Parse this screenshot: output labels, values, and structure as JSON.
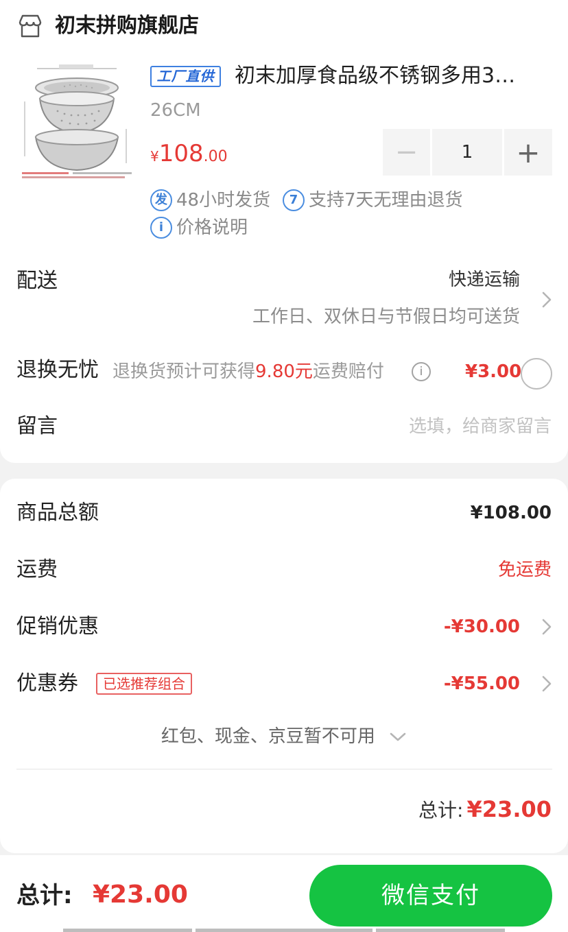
{
  "store": {
    "name": "初末拼购旗舰店",
    "icon": "store-icon"
  },
  "product": {
    "badge": "工厂直供",
    "title": "初末加厚食品级不锈钢多用3…",
    "spec": "26CM",
    "price_currency": "¥",
    "price_int": "108",
    "price_dec": ".00",
    "quantity": "1",
    "minus_glyph": "−",
    "plus_glyph": "+",
    "tags": [
      {
        "icon_text": "发",
        "label": "48小时发货"
      },
      {
        "icon_text": "7",
        "label": "支持7天无理由退货"
      },
      {
        "icon_text": "i",
        "label": "价格说明"
      }
    ]
  },
  "delivery": {
    "label": "配送",
    "method": "快递运输",
    "note": "工作日、双休日与节假日均可送货"
  },
  "returns": {
    "label": "退换无忧",
    "desc_prefix": "退换货预计可获得",
    "desc_amount": "9.80元",
    "desc_suffix": "运费赔付",
    "info_glyph": "i",
    "price": "¥3.00"
  },
  "message": {
    "label": "留言",
    "placeholder": "选填，给商家留言"
  },
  "summary": {
    "goods_label": "商品总额",
    "goods_value": "¥108.00",
    "shipping_label": "运费",
    "shipping_value": "免运费",
    "promo_label": "促销优惠",
    "promo_value": "-¥30.00",
    "coupon_label": "优惠券",
    "coupon_tag": "已选推荐组合",
    "coupon_value": "-¥55.00",
    "unavailable": "红包、现金、京豆暂不可用",
    "total_label": "总计:",
    "total_value": "¥23.00"
  },
  "bottom": {
    "total_label": "总计:",
    "total_value": "¥23.00",
    "pay_label": "微信支付"
  },
  "colors": {
    "accent_red": "#e53935",
    "pay_green": "#15c342",
    "link_blue": "#3a7fd6"
  }
}
